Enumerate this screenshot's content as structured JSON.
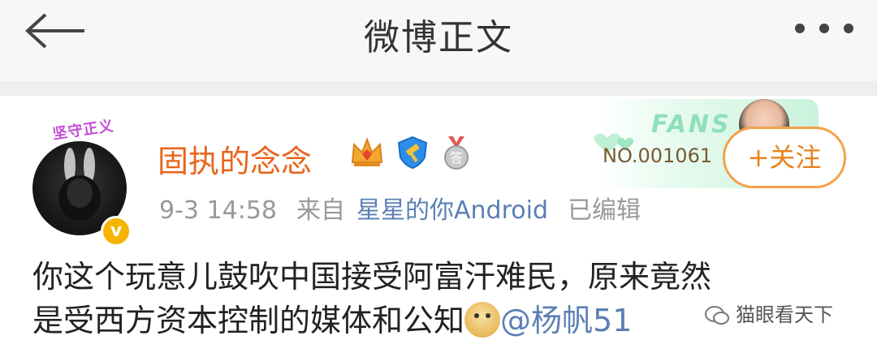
{
  "header": {
    "title": "微博正文"
  },
  "post": {
    "avatar_deco": "坚守正义",
    "verified_mark": "v",
    "username": "固执的念念",
    "badges": [
      "crown-icon",
      "shield-hammer-icon",
      "silver-medal-icon"
    ],
    "silver_badge_char": "答",
    "fans": {
      "label": "FANS",
      "number": "NO.001061"
    },
    "follow_label": "+关注",
    "time": "9-3 14:58",
    "source_prefix": "来自",
    "source": "星星的你Android",
    "edited": "已编辑",
    "content_line1": "你这个玩意儿鼓吹中国接受阿富汗难民，原来竟然",
    "content_line2": "是受西方资本控制的媒体和公知",
    "mention": "@杨帆51"
  },
  "watermark": "猫眼看天下",
  "colors": {
    "username": "#e9641d",
    "link": "#5b7fb4",
    "follow": "#e9821d",
    "meta": "#999999"
  }
}
